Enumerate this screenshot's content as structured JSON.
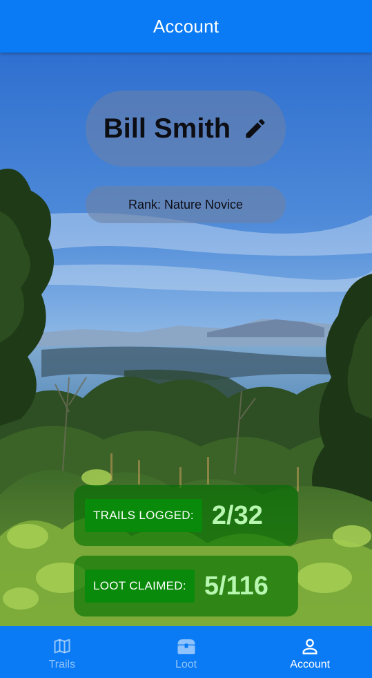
{
  "header": {
    "title": "Account"
  },
  "profile": {
    "name": "Bill Smith",
    "edit_icon": "pencil-icon",
    "rank": "Rank: Nature Novice"
  },
  "stats": {
    "trails": {
      "label": "TRAILS LOGGED:",
      "value": "2/32"
    },
    "loot": {
      "label": "LOOT CLAIMED:",
      "value": "5/116"
    }
  },
  "nav": {
    "tabs": [
      {
        "label": "Trails",
        "icon": "map-icon",
        "active": false
      },
      {
        "label": "Loot",
        "icon": "treasure-chest-icon",
        "active": false
      },
      {
        "label": "Account",
        "icon": "person-icon",
        "active": true
      }
    ]
  },
  "colors": {
    "header_bg": "#0a7bf5",
    "nav_bg": "#0a7bf5",
    "stat_card_bg": "#006e00",
    "stat_label_bg": "#0a8a0a",
    "stat_value": "#b8f7b0"
  }
}
